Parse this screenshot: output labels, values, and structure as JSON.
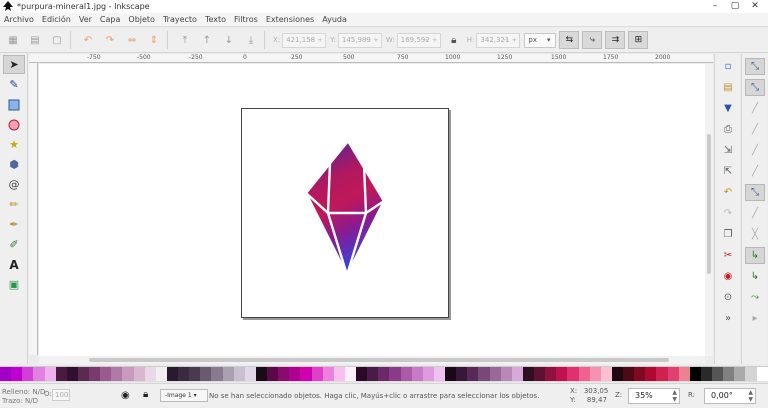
{
  "window": {
    "title": "*purpura-mineral1.jpg - Inkscape",
    "controls": [
      "–",
      "▢",
      "✕"
    ]
  },
  "menu": [
    "Archivo",
    "Edición",
    "Ver",
    "Capa",
    "Objeto",
    "Trayecto",
    "Texto",
    "Filtros",
    "Extensiones",
    "Ayuda"
  ],
  "toolctrl": {
    "x_label": "X:",
    "x_value": "421,158",
    "y_label": "Y:",
    "y_value": "145,989",
    "w_label": "W:",
    "w_value": "169,592",
    "h_label": "H:",
    "h_value": "342,321",
    "unit": "px"
  },
  "ruler_top": [
    "-750",
    "-500",
    "-250",
    "0",
    "250",
    "500",
    "750",
    "1000",
    "1250",
    "1500",
    "1750",
    "2000"
  ],
  "status": {
    "fill_label": "Relleno:",
    "fill_value": "N/D",
    "stroke_label": "Trazo:",
    "stroke_value": "N/D",
    "opacity_label": "O:",
    "opacity_value": "100",
    "layer": "-Image 1",
    "message": "No se han seleccionado objetos. Haga clic, Mayús+clic o arrastre para seleccionar los objetos.",
    "x_label": "X:",
    "x_value": "303,05",
    "y_label": "Y:",
    "y_value": "89,47",
    "zoom_label": "Z:",
    "zoom_value": "35%",
    "rotation_label": "R:",
    "rotation_value": "0,00°"
  },
  "palette": [
    "#a000c8",
    "#c000d0",
    "#d040d8",
    "#e080e0",
    "#f0b0f0",
    "#4a1a40",
    "#301030",
    "#5a2a50",
    "#7a3a70",
    "#9a5a90",
    "#b07aa8",
    "#c89ac0",
    "#d8b8d0",
    "#e8d8e8",
    "#f0f0f0",
    "#2a1a30",
    "#3a2a40",
    "#4a3a50",
    "#6a5a70",
    "#8a7a90",
    "#aaa0b0",
    "#c8c0d0",
    "#e0d8e8",
    "#1a0a18",
    "#5a0a48",
    "#8a0a70",
    "#b00090",
    "#d000b0",
    "#e040c8",
    "#f080e0",
    "#f8c0f0",
    "#fff0fb",
    "#2a0a28",
    "#4a1a48",
    "#6a2a68",
    "#8a3a88",
    "#aa5aa8",
    "#c87ac8",
    "#e09ae0",
    "#f0c0f0",
    "#180818",
    "#381838",
    "#582858",
    "#784878",
    "#986898",
    "#b888b8",
    "#d8a8d8",
    "#301020",
    "#601030",
    "#901040",
    "#c01050",
    "#e03070",
    "#f06090",
    "#f890b0",
    "#fcc0d0",
    "#200810",
    "#500818",
    "#800820",
    "#b00830",
    "#d02050",
    "#e04070",
    "#f08090",
    "#000000",
    "#2a2a2a",
    "#555555",
    "#808080",
    "#aaaaaa",
    "#d4d4d4",
    "#ffffff"
  ]
}
